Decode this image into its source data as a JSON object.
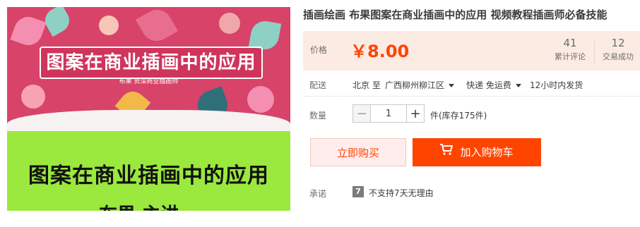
{
  "gallery": {
    "top_banner_text": "图案在商业插画中的应用",
    "top_sub_text": "布果  资深商业插画师",
    "bottom_text_line1": "图案在商业插画中的应用",
    "bottom_text_line2": "布果 主讲"
  },
  "product": {
    "title": "插画绘画 布果图案在商业插画中的应用 视频教程插画师必备技能"
  },
  "price": {
    "label": "价格",
    "value": "￥8.00",
    "reviews_count": "41",
    "reviews_label": "累计评论",
    "trades_count": "12",
    "trades_label": "交易成功"
  },
  "shipping": {
    "label": "配送",
    "from": "北京 至",
    "to": "广西柳州柳江区",
    "method": "快递 免运费",
    "dispatch": "12小时内发货"
  },
  "quantity": {
    "label": "数量",
    "minus": "−",
    "value": "1",
    "plus": "+",
    "stock_text": "件(库存175件)"
  },
  "actions": {
    "buy_now": "立即购买",
    "add_to_cart": "加入购物车"
  },
  "promise": {
    "label": "承诺",
    "badge": "7",
    "text": "不支持7天无理由"
  },
  "colors": {
    "accent": "#ff4400",
    "price_bg": "#fcebe3",
    "banner_pink": "#d8436a",
    "banner_green": "#9be83e"
  }
}
